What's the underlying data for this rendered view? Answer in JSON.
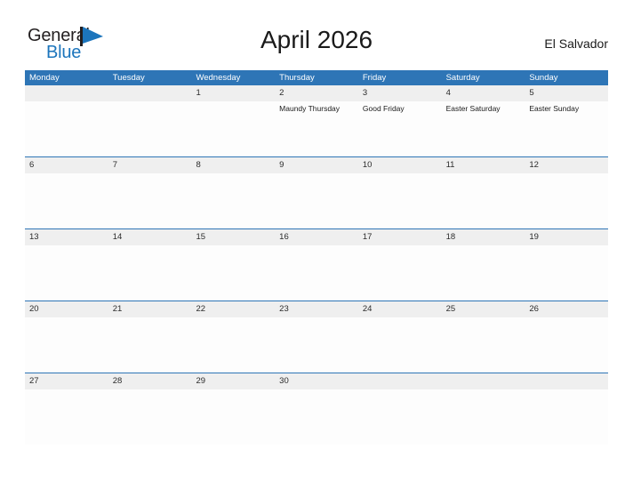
{
  "brand": {
    "name_part1": "General",
    "name_part2": "Blue",
    "flag_icon": "blue-flag-triangle-icon",
    "color_dark": "#231f20",
    "color_blue": "#1c75bc"
  },
  "header": {
    "title": "April 2026",
    "region": "El Salvador"
  },
  "theme": {
    "header_blue": "#2e75b6",
    "band_gray": "#efefef",
    "cell_white": "#fdfdfd",
    "text_dark": "#1a1a1a"
  },
  "weekdays": [
    "Monday",
    "Tuesday",
    "Wednesday",
    "Thursday",
    "Friday",
    "Saturday",
    "Sunday"
  ],
  "weeks": [
    {
      "days": [
        {
          "num": "",
          "events": []
        },
        {
          "num": "",
          "events": []
        },
        {
          "num": "1",
          "events": []
        },
        {
          "num": "2",
          "events": [
            "Maundy Thursday"
          ]
        },
        {
          "num": "3",
          "events": [
            "Good Friday"
          ]
        },
        {
          "num": "4",
          "events": [
            "Easter Saturday"
          ]
        },
        {
          "num": "5",
          "events": [
            "Easter Sunday"
          ]
        }
      ]
    },
    {
      "days": [
        {
          "num": "6",
          "events": []
        },
        {
          "num": "7",
          "events": []
        },
        {
          "num": "8",
          "events": []
        },
        {
          "num": "9",
          "events": []
        },
        {
          "num": "10",
          "events": []
        },
        {
          "num": "11",
          "events": []
        },
        {
          "num": "12",
          "events": []
        }
      ]
    },
    {
      "days": [
        {
          "num": "13",
          "events": []
        },
        {
          "num": "14",
          "events": []
        },
        {
          "num": "15",
          "events": []
        },
        {
          "num": "16",
          "events": []
        },
        {
          "num": "17",
          "events": []
        },
        {
          "num": "18",
          "events": []
        },
        {
          "num": "19",
          "events": []
        }
      ]
    },
    {
      "days": [
        {
          "num": "20",
          "events": []
        },
        {
          "num": "21",
          "events": []
        },
        {
          "num": "22",
          "events": []
        },
        {
          "num": "23",
          "events": []
        },
        {
          "num": "24",
          "events": []
        },
        {
          "num": "25",
          "events": []
        },
        {
          "num": "26",
          "events": []
        }
      ]
    },
    {
      "days": [
        {
          "num": "27",
          "events": []
        },
        {
          "num": "28",
          "events": []
        },
        {
          "num": "29",
          "events": []
        },
        {
          "num": "30",
          "events": []
        },
        {
          "num": "",
          "events": []
        },
        {
          "num": "",
          "events": []
        },
        {
          "num": "",
          "events": []
        }
      ]
    }
  ]
}
